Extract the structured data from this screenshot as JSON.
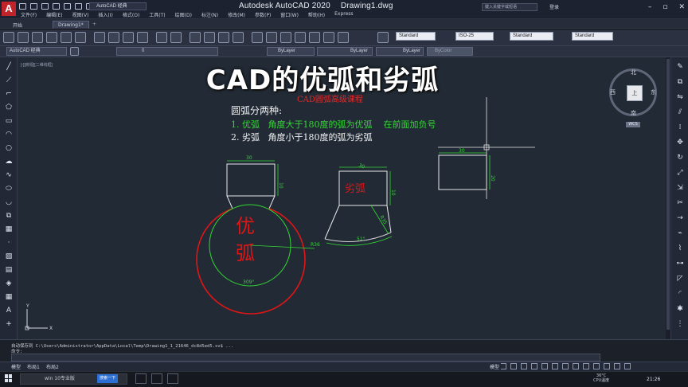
{
  "window": {
    "app_logo": "A",
    "workspace": "AutoCAD 经典",
    "app_name": "Autodesk AutoCAD 2020",
    "doc_name": "Drawing1.dwg",
    "search_placeholder": "键入关键字或短语",
    "login": "登录"
  },
  "menubar": [
    "文件(F)",
    "编辑(E)",
    "视图(V)",
    "插入(I)",
    "格式(O)",
    "工具(T)",
    "绘图(D)",
    "标注(N)",
    "修改(M)",
    "参数(P)",
    "窗口(W)",
    "帮助(H)",
    "Express"
  ],
  "tabs": {
    "start": "开始",
    "doc": "Drawing1*",
    "plus": "+"
  },
  "toolbar": {
    "text_style": "Standard",
    "dim_style": "ISO-25",
    "table_style": "Standard",
    "mleader_style": "Standard",
    "workspace2": "AutoCAD 经典",
    "layer": "0",
    "color": "ByLayer",
    "linetype": "ByLayer",
    "lineweight": "ByLayer",
    "plotstyle": "ByColor"
  },
  "viewport_label": "[-][俯视][二维线框]",
  "overlay_title": "CAD的优弧和劣弧",
  "course_title": "CAD圆弧高级课程",
  "notes": {
    "head": "圆弧分两种:",
    "line1": "1. 优弧   角度大于180度的弧为优弧    在前面加负号",
    "line2": "2. 劣弧   角度小于180度的弧为劣弧"
  },
  "labels": {
    "major_1": "优",
    "major_2": "弧",
    "minor": "劣弧",
    "dim30_a": "30",
    "dim10_a": "10",
    "r36": "R36",
    "angle309": "309°",
    "dim30_b": "30",
    "dim10_b": "10",
    "r35": "R35",
    "angle51": "51°",
    "dim30_c": "30",
    "dim20_c": "20"
  },
  "viewcube": {
    "top": "上",
    "north": "北",
    "south": "南",
    "east": "东",
    "west": "西",
    "wcs": "WCS"
  },
  "ucs": {
    "x": "X",
    "y": "Y"
  },
  "command": {
    "line1": "自动保存到 C:\\Users\\Administrator\\AppData\\Local\\Temp\\Drawing1_1_21646_dc8d5ed5.sv$ ...",
    "line2": "命令:"
  },
  "layout_tabs": [
    "模型",
    "布局1",
    "布局2"
  ],
  "status": {
    "model": "模型"
  },
  "taskbar": {
    "search": "win 10专业版",
    "hint": "搜索一下",
    "temp": "36°C",
    "cpu": "CPU温度",
    "time": "21:26"
  },
  "colors": {
    "green": "#33d833",
    "red": "#e01616",
    "canvas": "#212a35"
  }
}
